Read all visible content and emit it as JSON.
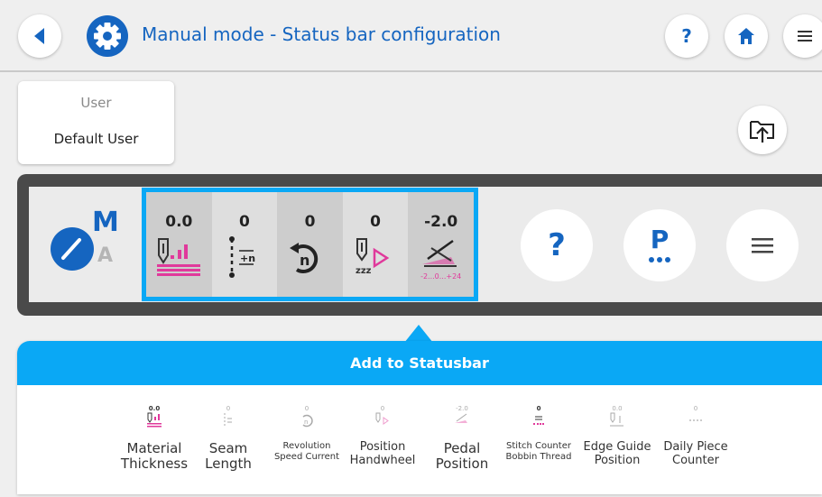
{
  "header": {
    "title": "Manual mode - Status bar configuration",
    "help_label": "?"
  },
  "user": {
    "label": "User",
    "value": "Default User"
  },
  "mode_indicator": {
    "manual": "M",
    "auto": "A"
  },
  "statusbar": {
    "cells": [
      {
        "value": "0.0",
        "icon": "material-thickness-icon"
      },
      {
        "value": "0",
        "icon": "seam-length-icon"
      },
      {
        "value": "0",
        "icon": "revolution-speed-icon"
      },
      {
        "value": "0",
        "icon": "position-handwheel-icon"
      },
      {
        "value": "-2.0",
        "icon": "pedal-position-icon",
        "scale": "-2...0...+24"
      }
    ],
    "help_label": "?",
    "program_label": "P"
  },
  "add_panel": {
    "title": "Add to Statusbar",
    "items": [
      {
        "value": "0.0",
        "label1": "Material",
        "label2": "Thickness"
      },
      {
        "value": "0",
        "label1": "Seam",
        "label2": "Length"
      },
      {
        "value": "0",
        "label1": "Revolution",
        "label2": "Speed Current"
      },
      {
        "value": "0",
        "label1": "Position",
        "label2": "Handwheel"
      },
      {
        "value": "-2.0",
        "label1": "Pedal",
        "label2": "Position"
      },
      {
        "value": "0",
        "label1": "Stitch Counter",
        "label2": "Bobbin Thread"
      },
      {
        "value": "0.0",
        "label1": "Edge Guide",
        "label2": "Position"
      },
      {
        "value": "0",
        "label1": "Daily Piece",
        "label2": "Counter"
      }
    ]
  },
  "colors": {
    "accent": "#0aa8f5",
    "brand_blue": "#1565c0",
    "magenta": "#e0399b"
  }
}
